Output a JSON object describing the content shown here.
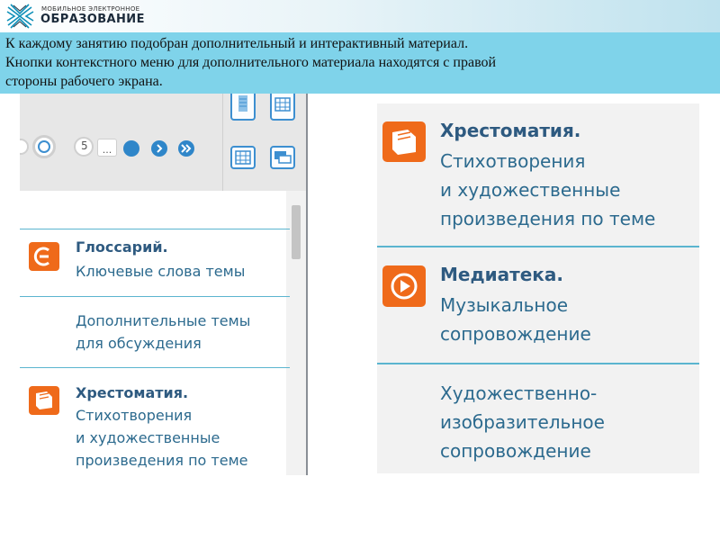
{
  "logo": {
    "line1": "МОБИЛЬНОЕ ЭЛЕКТРОННОЕ",
    "line2": "ОБРАЗОВАНИЕ",
    "icon": "logo-knot-icon",
    "brand_color": "#0d8fb8"
  },
  "description": {
    "line1": "К каждому занятию подобран дополнительный и интерактивный материал.",
    "line2": "Кнопки контекстного меню для дополнительного материала находятся с правой",
    "line3": "стороны рабочего экрана."
  },
  "player": {
    "page_label": "5",
    "ellipsis": "...",
    "icons": [
      "document-icon",
      "table-icon",
      "grid-icon",
      "chat-icon"
    ]
  },
  "left_menu": {
    "glossary": {
      "title": "Глоссарий.",
      "subtitle": "Ключевые слова темы",
      "icon": "glossary-icon"
    },
    "extra_topics": {
      "line1": "Дополнительные темы",
      "line2": "для обсуждения"
    },
    "reader": {
      "title": "Хрестоматия.",
      "line1": "Стихотворения",
      "line2": "и художественные",
      "line3": "произведения по теме",
      "icon": "book-icon"
    }
  },
  "right_menu": {
    "reader": {
      "title": "Хрестоматия.",
      "line1": "Стихотворения",
      "line2": "и художественные",
      "line3": "произведения по теме",
      "icon": "book-icon"
    },
    "media": {
      "title": "Медиатека.",
      "line1": "Музыкальное",
      "line2": "сопровождение",
      "icon": "play-icon"
    },
    "art": {
      "line1": "Художественно-",
      "line2": "изобразительное",
      "line3": "сопровождение"
    }
  },
  "colors": {
    "accent_orange": "#ef6a1a",
    "title_blue": "#2e5a80",
    "text_blue": "#2c6a8e",
    "separator": "#5bb5cf",
    "banner": "#7fd3ea"
  }
}
